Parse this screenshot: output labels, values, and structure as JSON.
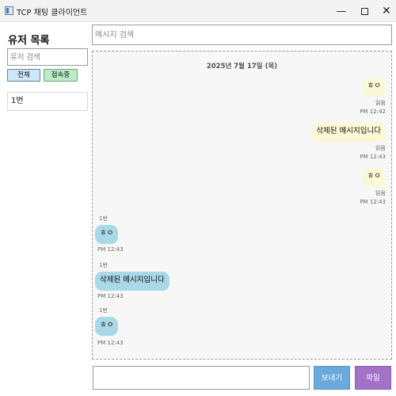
{
  "window": {
    "title": "TCP 채팅 클라이언트",
    "minimize_glyph": "—",
    "close_glyph": "✕"
  },
  "sidebar": {
    "title": "유저 목록",
    "search_placeholder": "유저 검색",
    "filters": [
      {
        "label": "전체",
        "color": "#cfe6f7"
      },
      {
        "label": "접속중",
        "color": "#b9ecc6"
      }
    ],
    "users": [
      {
        "name": "1번"
      }
    ]
  },
  "main": {
    "message_search_placeholder": "메시지 검색",
    "date_divider": "2025년 7월 17일 (목)",
    "messages": [
      {
        "side": "mine",
        "text": "ㅎㅇ",
        "status": "읽음",
        "time": "PM 12:42"
      },
      {
        "side": "mine",
        "text": "삭제된 메시지입니다",
        "status": "읽음",
        "time": "PM 12:43"
      },
      {
        "side": "mine",
        "text": "ㅎㅇ",
        "status": "읽음",
        "time": "PM 12:43"
      },
      {
        "side": "theirs",
        "sender": "1번",
        "text": "ㅎㅇ",
        "time": "PM 12:43"
      },
      {
        "side": "theirs",
        "sender": "1번",
        "text": "삭제된 메시지입니다",
        "time": "PM 12:43"
      },
      {
        "side": "theirs",
        "sender": "1번",
        "text": "ㅎㅇ",
        "time": "PM 12:43"
      }
    ],
    "input_value": "",
    "send_label": "보내기",
    "file_label": "파일"
  },
  "colors": {
    "mine_bubble": "#fbf8d6",
    "theirs_bubble": "#a9d8e6",
    "send_button": "#69aadb",
    "file_button": "#a272c7"
  },
  "icons": {
    "app": "app-window-icon",
    "minimize": "minimize-icon",
    "maximize": "maximize-icon",
    "close": "close-icon"
  }
}
